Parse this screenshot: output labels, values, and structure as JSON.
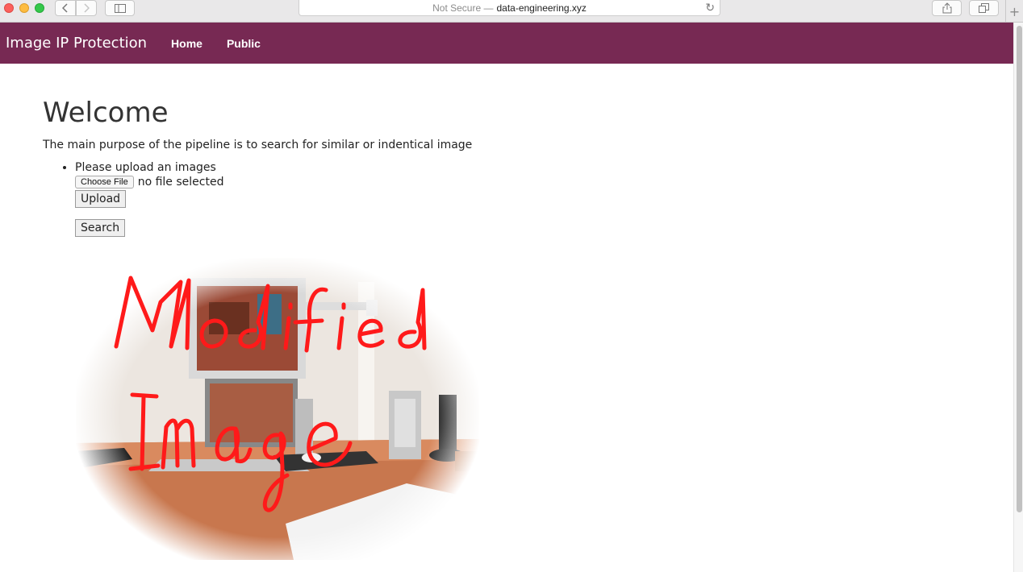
{
  "browser": {
    "security": "Not Secure —",
    "domain": "data-engineering.xyz"
  },
  "navbar": {
    "brand": "Image IP Protection",
    "links": [
      "Home",
      "Public"
    ]
  },
  "main": {
    "title": "Welcome",
    "lead": "The main purpose of the pipeline is to search for similar or indentical image",
    "upload_prompt": "Please upload an images",
    "choose_file": "Choose File",
    "file_status": "no file selected",
    "upload_button": "Upload",
    "search_button": "Search"
  },
  "image": {
    "overlay_line1": "Modified",
    "overlay_line2": "Image"
  },
  "colors": {
    "navbar": "#772953",
    "overlay_text": "#ff1a1a"
  }
}
